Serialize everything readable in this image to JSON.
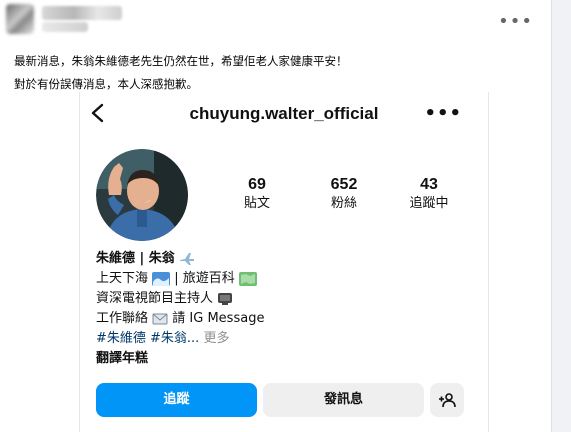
{
  "post": {
    "text_lines": [
      "最新消息，朱翁朱維德老先生仍然在世，希望佢老人家健康平安！",
      "對於有份誤傳消息，本人深感抱歉。"
    ],
    "more_icon": "more-horizontal-icon"
  },
  "profile": {
    "username": "chuyung.walter_official",
    "back_icon": "chevron-left-icon",
    "more_icon": "more-horizontal-icon",
    "stats": [
      {
        "value": "69",
        "label": "貼文"
      },
      {
        "value": "652",
        "label": "粉絲"
      },
      {
        "value": "43",
        "label": "追蹤中"
      }
    ],
    "bio": {
      "name": "朱維德 | 朱翁",
      "line1_a": "上天下海",
      "line1_b": "| 旅遊百科",
      "line2": "資深電視節目主持人",
      "line3_a": "工作聯絡",
      "line3_b": "請 IG Message",
      "hashtags": "#朱維德 #朱翁...",
      "more": "更多",
      "translate": "翻譯年糕"
    },
    "buttons": {
      "follow": "追蹤",
      "message": "發訊息",
      "add_user": "+"
    },
    "colors": {
      "follow_blue": "#0095f6",
      "hashtag": "#00376b"
    }
  }
}
